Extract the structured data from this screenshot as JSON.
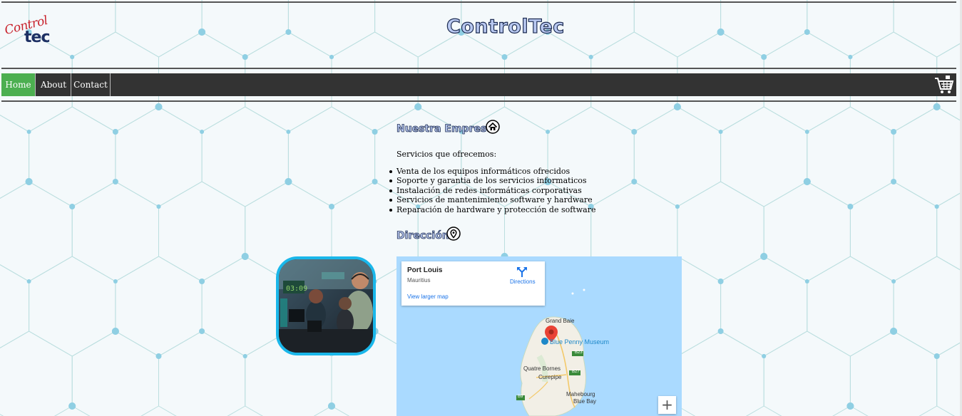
{
  "logo": {
    "line1": "Control",
    "line2": "tec"
  },
  "site_title": "ControlTec",
  "nav": {
    "items": [
      "Home",
      "About",
      "Contact"
    ],
    "active": "Home",
    "cart_icon": "shopping-cart-icon"
  },
  "colors": {
    "nav_bg": "#333333",
    "nav_active": "#4caf50",
    "photo_border": "#1ab7ea",
    "heading_fill": "#b9c9f1",
    "heading_outline": "#1d2c52",
    "map_water": "#aadaff"
  },
  "company": {
    "heading": "Nuestra Empresa",
    "heading_icon": "home-icon",
    "intro": "Servicios que ofrecemos:",
    "services": [
      "Venta de los equipos informáticos ofrecidos",
      "Soporte y garantia de los servicios informaticos",
      "Instalación de redes informáticas corporativas",
      "Servicios de mantenimiento software y hardware",
      "Reparación de hardware y protección de software"
    ]
  },
  "address": {
    "heading": "Dirección",
    "heading_icon": "map-pin-icon"
  },
  "map": {
    "card": {
      "place": "Port Louis",
      "country": "Mauritius",
      "directions_label": "Directions",
      "view_larger": "View larger map"
    },
    "labels": {
      "grand_baie": "Grand Baie",
      "poi": "Blue Penny Museum",
      "quatre_bornes": "Quatre Bornes",
      "curepipe": "Curepipe",
      "mahebourg": "Mahebourg",
      "blue_bay": "Blue Bay",
      "road_b23": "B23",
      "road_b27": "B27",
      "road_b9": "B9"
    },
    "zoom_in": "+"
  }
}
